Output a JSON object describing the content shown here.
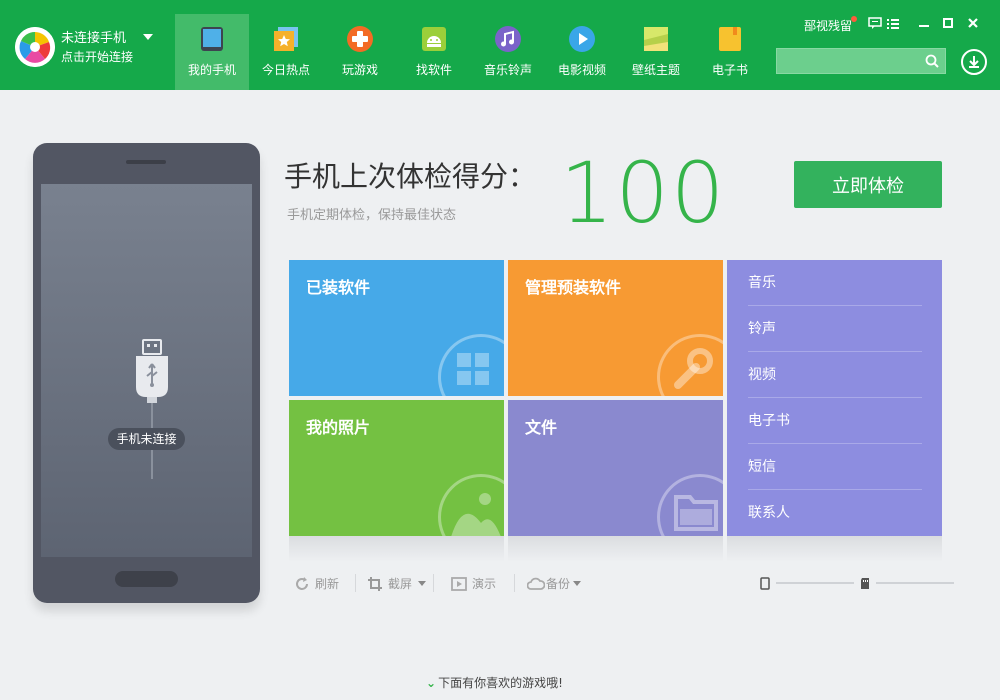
{
  "header": {
    "connection_title": "未连接手机",
    "connection_subtitle": "点击开始连接",
    "nav": [
      {
        "label": "我的手机",
        "icon": "tablet-icon",
        "active": true
      },
      {
        "label": "今日热点",
        "icon": "star-icon",
        "active": false
      },
      {
        "label": "玩游戏",
        "icon": "gamepad-icon",
        "active": false
      },
      {
        "label": "找软件",
        "icon": "android-icon",
        "active": false
      },
      {
        "label": "音乐铃声",
        "icon": "music-note-icon",
        "active": false
      },
      {
        "label": "电影视频",
        "icon": "play-icon",
        "active": false
      },
      {
        "label": "壁纸主题",
        "icon": "wallpaper-icon",
        "active": false
      },
      {
        "label": "电子书",
        "icon": "book-icon",
        "active": false
      }
    ],
    "feedback_label": "郚视残留",
    "search_placeholder": ""
  },
  "phone": {
    "status": "手机未连接"
  },
  "checkup": {
    "title": "手机上次体检得分：",
    "subtitle": "手机定期体检，保持最佳状态",
    "score": "100",
    "button": "立即体检"
  },
  "tiles": [
    {
      "label": "已装软件",
      "color": "#46a9e8",
      "icon": "grid-icon"
    },
    {
      "label": "管理预装软件",
      "color": "#f79a33",
      "icon": "wrench-icon"
    },
    {
      "label": "我的照片",
      "color": "#74c142",
      "icon": "photo-icon"
    },
    {
      "label": "文件",
      "color": "#8a89cf",
      "icon": "folder-icon"
    }
  ],
  "side_list": [
    "音乐",
    "铃声",
    "视频",
    "电子书",
    "短信",
    "联系人"
  ],
  "toolbar": {
    "refresh": "刷新",
    "screenshot": "截屏",
    "demo": "演示",
    "backup": "备份"
  },
  "bottom_tip": "下面有你喜欢的游戏哦!"
}
